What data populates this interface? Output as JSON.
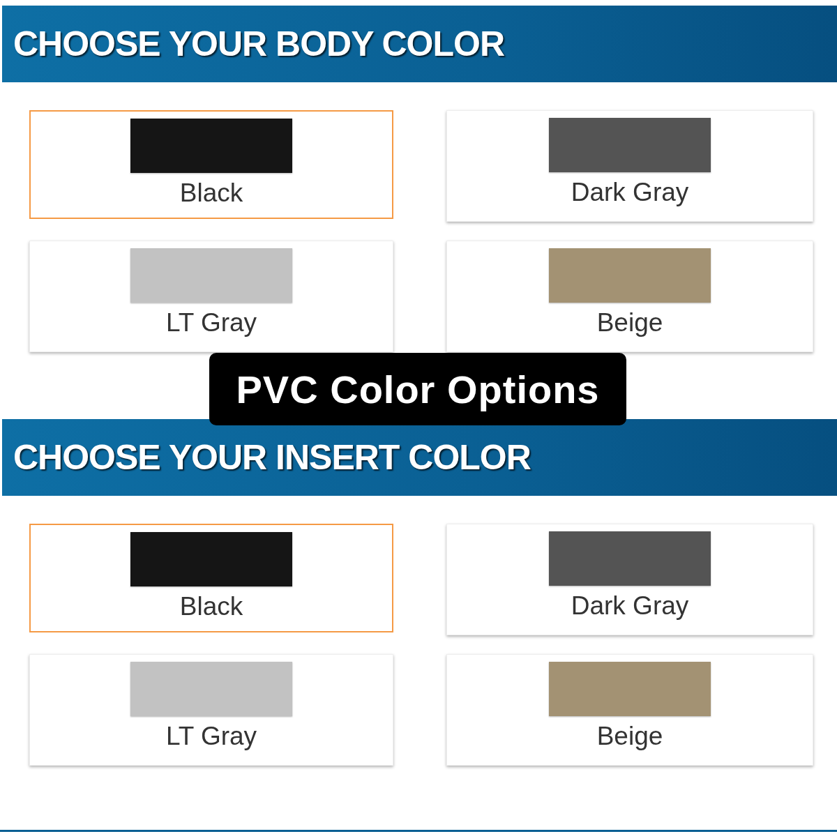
{
  "sections": [
    {
      "title": "CHOOSE YOUR BODY COLOR",
      "swatches": [
        {
          "label": "Black",
          "color": "#151515",
          "selected": true
        },
        {
          "label": "Dark Gray",
          "color": "#545454",
          "selected": false
        },
        {
          "label": "LT Gray",
          "color": "#c2c2c2",
          "selected": false
        },
        {
          "label": "Beige",
          "color": "#a39273",
          "selected": false
        }
      ]
    },
    {
      "title": "CHOOSE YOUR INSERT COLOR",
      "swatches": [
        {
          "label": "Black",
          "color": "#151515",
          "selected": true
        },
        {
          "label": "Dark Gray",
          "color": "#545454",
          "selected": false
        },
        {
          "label": "LT Gray",
          "color": "#c2c2c2",
          "selected": false
        },
        {
          "label": "Beige",
          "color": "#a39273",
          "selected": false
        }
      ]
    }
  ],
  "caption": "PVC Color Options"
}
